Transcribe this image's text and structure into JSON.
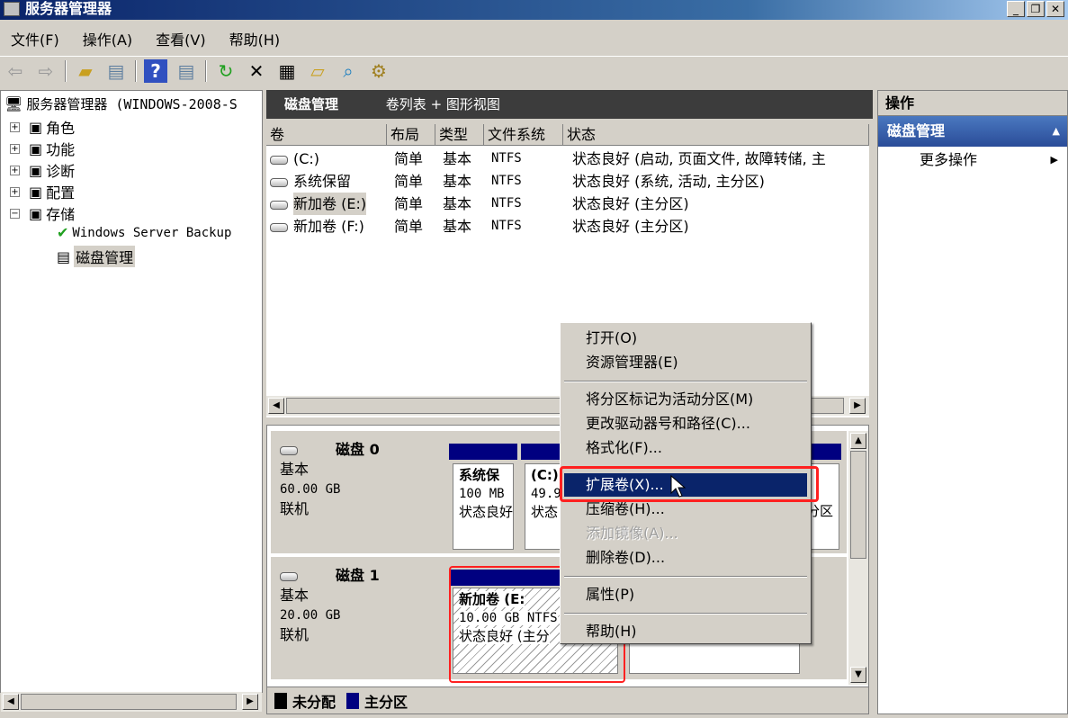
{
  "window": {
    "title": "服务器管理器",
    "min": "_",
    "restore": "❐",
    "close": "✕"
  },
  "menu": [
    "文件(F)",
    "操作(A)",
    "查看(V)",
    "帮助(H)"
  ],
  "toolbar": [
    "back-icon",
    "forward-icon",
    "up-folder-icon",
    "show-hide-tree-icon",
    "help-icon",
    "show-hide-action-icon",
    "refresh-icon",
    "delete-icon",
    "properties-icon",
    "open-icon",
    "find-icon",
    "settings-icon"
  ],
  "tree": {
    "root": "服务器管理器 (WINDOWS-2008-S",
    "items": [
      {
        "label": "角色",
        "exp": "+"
      },
      {
        "label": "功能",
        "exp": "+"
      },
      {
        "label": "诊断",
        "exp": "+"
      },
      {
        "label": "配置",
        "exp": "+"
      },
      {
        "label": "存储",
        "exp": "−"
      }
    ],
    "children": [
      "Windows Server Backup",
      "磁盘管理"
    ]
  },
  "center": {
    "title": "磁盘管理",
    "view": "卷列表 + 图形视图",
    "columns": [
      "卷",
      "布局",
      "类型",
      "文件系统",
      "状态"
    ],
    "rows": [
      {
        "vol": " (C:)",
        "layout": "简单",
        "type": "基本",
        "fs": "NTFS",
        "status": "状态良好 (启动, 页面文件, 故障转储, 主"
      },
      {
        "vol": "系统保留",
        "layout": "简单",
        "type": "基本",
        "fs": "NTFS",
        "status": "状态良好 (系统, 活动, 主分区)"
      },
      {
        "vol": "新加卷 (E:)",
        "layout": "简单",
        "type": "基本",
        "fs": "NTFS",
        "status": "状态良好 (主分区)"
      },
      {
        "vol": "新加卷 (F:)",
        "layout": "简单",
        "type": "基本",
        "fs": "NTFS",
        "status": "状态良好 (主分区)"
      }
    ],
    "disks": [
      {
        "name": "磁盘 0",
        "kind": "基本",
        "size": "60.00 GB",
        "state": "联机",
        "parts": [
          {
            "l1": "系统保",
            "l2": "100 MB",
            "l3": "状态良好"
          },
          {
            "l1": "(C:)",
            "l2": "49.9",
            "l3": "状态"
          },
          {
            "l1": "",
            "l2": "",
            "l3": "分区"
          }
        ]
      },
      {
        "name": "磁盘 1",
        "kind": "基本",
        "size": "20.00 GB",
        "state": "联机",
        "parts": [
          {
            "l1": "新加卷  (E:",
            "l2": "10.00 GB NTFS",
            "l3": "状态良好 (主分"
          },
          {
            "l1": "",
            "l2": "",
            "l3": ""
          }
        ]
      }
    ],
    "legend": [
      {
        "label": "未分配",
        "color": "#000000"
      },
      {
        "label": "主分区",
        "color": "#000080"
      }
    ]
  },
  "actions": {
    "title": "操作",
    "section": "磁盘管理",
    "more": "更多操作"
  },
  "context_menu": [
    {
      "label": "打开(O)"
    },
    {
      "label": "资源管理器(E)"
    },
    {
      "sep": true
    },
    {
      "label": "将分区标记为活动分区(M)"
    },
    {
      "label": "更改驱动器号和路径(C)..."
    },
    {
      "label": "格式化(F)..."
    },
    {
      "sep": true
    },
    {
      "label": "扩展卷(X)...",
      "highlighted": true
    },
    {
      "label": "压缩卷(H)..."
    },
    {
      "label": "添加镜像(A)...",
      "disabled": true
    },
    {
      "label": "删除卷(D)..."
    },
    {
      "sep": true
    },
    {
      "label": "属性(P)"
    },
    {
      "sep": true
    },
    {
      "label": "帮助(H)"
    }
  ],
  "colors": {
    "highlight": "#0a246a",
    "annotation": "#ff2020",
    "partition": "#000080"
  }
}
